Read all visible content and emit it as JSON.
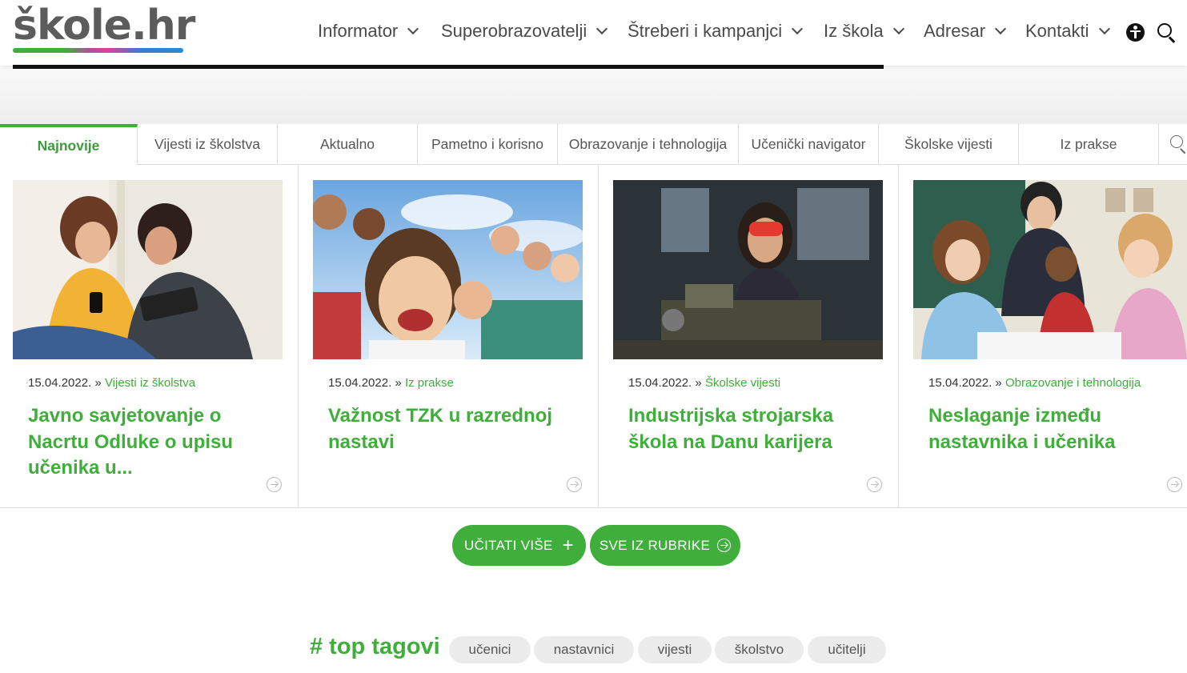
{
  "logo": {
    "text": "škole.hr"
  },
  "nav": {
    "items": [
      {
        "label": "Informator"
      },
      {
        "label": "Superobrazovatelji"
      },
      {
        "label": "Štreberi i kampanjci"
      },
      {
        "label": "Iz škola"
      },
      {
        "label": "Adresar"
      },
      {
        "label": "Kontakti"
      }
    ],
    "accessibility_icon": "accessibility-icon",
    "search_icon": "search-icon"
  },
  "tabs": {
    "items": [
      {
        "label": "Najnovije",
        "active": true
      },
      {
        "label": "Vijesti iz školstva"
      },
      {
        "label": "Aktualno"
      },
      {
        "label": "Pametno i korisno"
      },
      {
        "label": "Obrazovanje i tehnologija"
      },
      {
        "label": "Učenički navigator"
      },
      {
        "label": "Školske vijesti"
      },
      {
        "label": "Iz prakse"
      }
    ]
  },
  "articles": [
    {
      "date": "15.04.2022.",
      "separator": "»",
      "category": "Vijesti iz školstva",
      "title": "Javno savjetovanje o Nacrtu Odluke o upisu učenika u..."
    },
    {
      "date": "15.04.2022.",
      "separator": "»",
      "category": "Iz prakse",
      "title": "Važnost TZK u razrednoj nastavi"
    },
    {
      "date": "15.04.2022.",
      "separator": "»",
      "category": "Školske vijesti",
      "title": "Industrijska strojarska škola na Danu karijera"
    },
    {
      "date": "15.04.2022.",
      "separator": "»",
      "category": "Obrazovanje i tehnologija",
      "title": "Neslaganje između nastavnika i učenika"
    }
  ],
  "buttons": {
    "load_more": "UČITATI VIŠE",
    "load_more_icon": "+",
    "all_from_section": "SVE IZ RUBRIKE"
  },
  "tags": {
    "title": "# top tagovi",
    "items": [
      "učenici",
      "nastavnici",
      "vijesti",
      "školstvo",
      "učitelji"
    ]
  },
  "colors": {
    "accent_green": "#3fae3a",
    "text_dark": "#4a4a4a"
  }
}
